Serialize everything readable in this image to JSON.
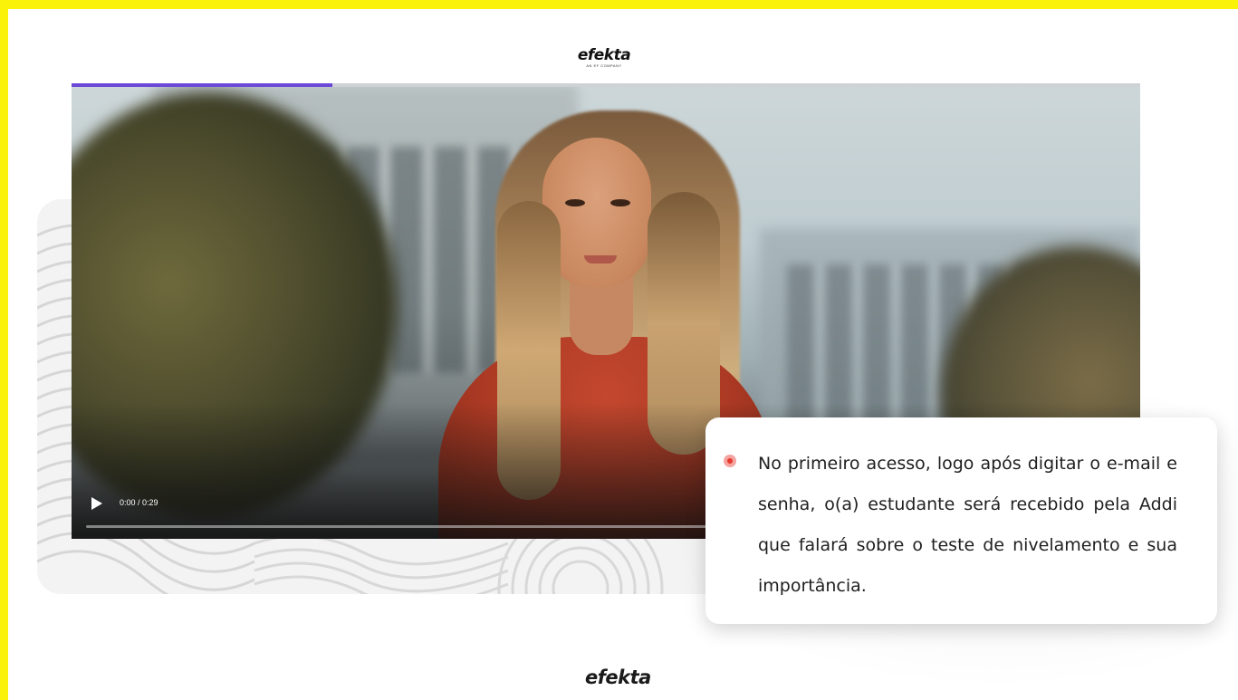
{
  "header": {
    "logo_text": "efekta",
    "logo_tagline": "AN EF COMPANY"
  },
  "video": {
    "time": "0:00 / 0:29",
    "top_progress": 0.244,
    "playback_progress": 0.0,
    "play_icon": "play-icon"
  },
  "callout": {
    "bullet_icon": "target-bullet-icon",
    "text": "No primeiro acesso, logo após digitar o e-mail e senha, o(a) estudante será recebido pela Addi que falará sobre o teste de nivelamento e sua importância."
  },
  "footer": {
    "logo_text": "efekta"
  },
  "colors": {
    "frame_border": "#fbf20a",
    "progress_accent": "#6c48d8",
    "bullet": "#e8392f"
  }
}
